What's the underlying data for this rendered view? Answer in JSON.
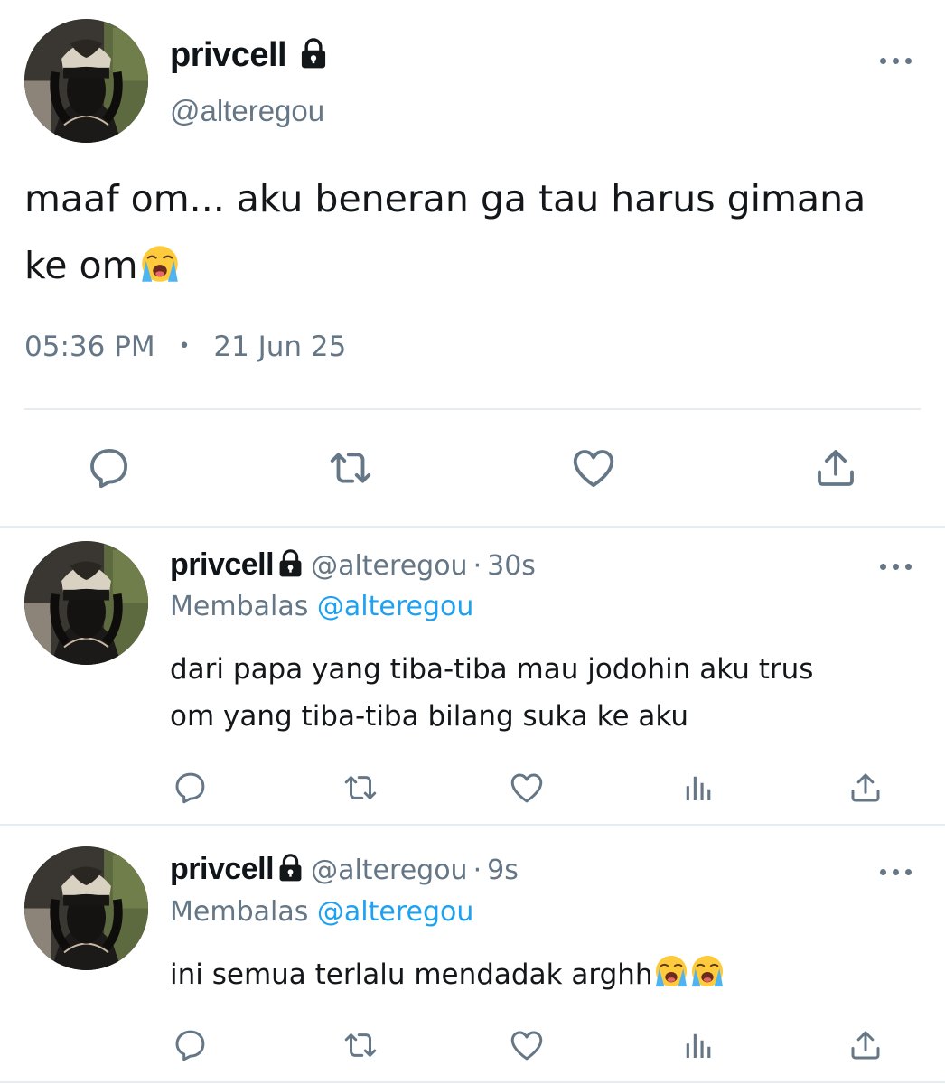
{
  "main_tweet": {
    "display_name": "privcell",
    "handle": "@alteregou",
    "text_line1": "maaf om... aku beneran ga tau harus gimana",
    "text_line2": "ke om",
    "emoji": "loudly-crying-face",
    "time": "05:36 PM",
    "separator": "•",
    "date": "21 Jun 25",
    "actions": [
      "reply-icon",
      "retweet-icon",
      "like-icon",
      "share-icon"
    ]
  },
  "replies": [
    {
      "display_name": "privcell",
      "handle": "@alteregou",
      "dot": "·",
      "time": "30s",
      "replying_label": "Membalas",
      "replying_to": "@alteregou",
      "text_line1": "dari papa yang tiba-tiba mau jodohin aku trus",
      "text_line2": "om yang tiba-tiba bilang suka ke aku",
      "actions": [
        "reply-icon",
        "retweet-icon",
        "like-icon",
        "analytics-icon",
        "share-icon"
      ]
    },
    {
      "display_name": "privcell",
      "handle": "@alteregou",
      "dot": "·",
      "time": "9s",
      "replying_label": "Membalas",
      "replying_to": "@alteregou",
      "text_line1": "ini semua terlalu mendadak arghh",
      "emoji_count": 2,
      "actions": [
        "reply-icon",
        "retweet-icon",
        "like-icon",
        "analytics-icon",
        "share-icon"
      ]
    }
  ],
  "colors": {
    "text": "#14171a",
    "secondary": "#657786",
    "link": "#1da1f2",
    "divider": "#e6ecf0"
  }
}
